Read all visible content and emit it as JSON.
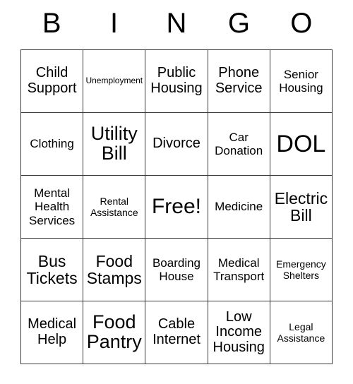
{
  "card": {
    "header_letters": [
      "B",
      "I",
      "N",
      "G",
      "O"
    ],
    "free_space_label": "Free!",
    "grid": [
      [
        {
          "label": "Child Support",
          "size": "lg"
        },
        {
          "label": "Unemployment",
          "size": "xs"
        },
        {
          "label": "Public Housing",
          "size": "lg"
        },
        {
          "label": "Phone Service",
          "size": "lg"
        },
        {
          "label": "Senior Housing",
          "size": "md"
        }
      ],
      [
        {
          "label": "Clothing",
          "size": "md"
        },
        {
          "label": "Utility Bill",
          "size": "2xl"
        },
        {
          "label": "Divorce",
          "size": "lg"
        },
        {
          "label": "Car Donation",
          "size": "md"
        },
        {
          "label": "DOL",
          "size": "4xl"
        }
      ],
      [
        {
          "label": "Mental Health Services",
          "size": "md"
        },
        {
          "label": "Rental Assistance",
          "size": "sm"
        },
        {
          "label": "Free!",
          "size": "3xl"
        },
        {
          "label": "Medicine",
          "size": "md"
        },
        {
          "label": "Electric Bill",
          "size": "xl"
        }
      ],
      [
        {
          "label": "Bus Tickets",
          "size": "xl"
        },
        {
          "label": "Food Stamps",
          "size": "xl"
        },
        {
          "label": "Boarding House",
          "size": "md"
        },
        {
          "label": "Medical Transport",
          "size": "md"
        },
        {
          "label": "Emergency Shelters",
          "size": "sm"
        }
      ],
      [
        {
          "label": "Medical Help",
          "size": "lg"
        },
        {
          "label": "Food Pantry",
          "size": "2xl"
        },
        {
          "label": "Cable Internet",
          "size": "lg"
        },
        {
          "label": "Low Income Housing",
          "size": "lg"
        },
        {
          "label": "Legal Assistance",
          "size": "sm"
        }
      ]
    ]
  },
  "colors": {
    "background": "#ffffff",
    "text": "#000000",
    "grid_line": "#3a3a3a"
  }
}
